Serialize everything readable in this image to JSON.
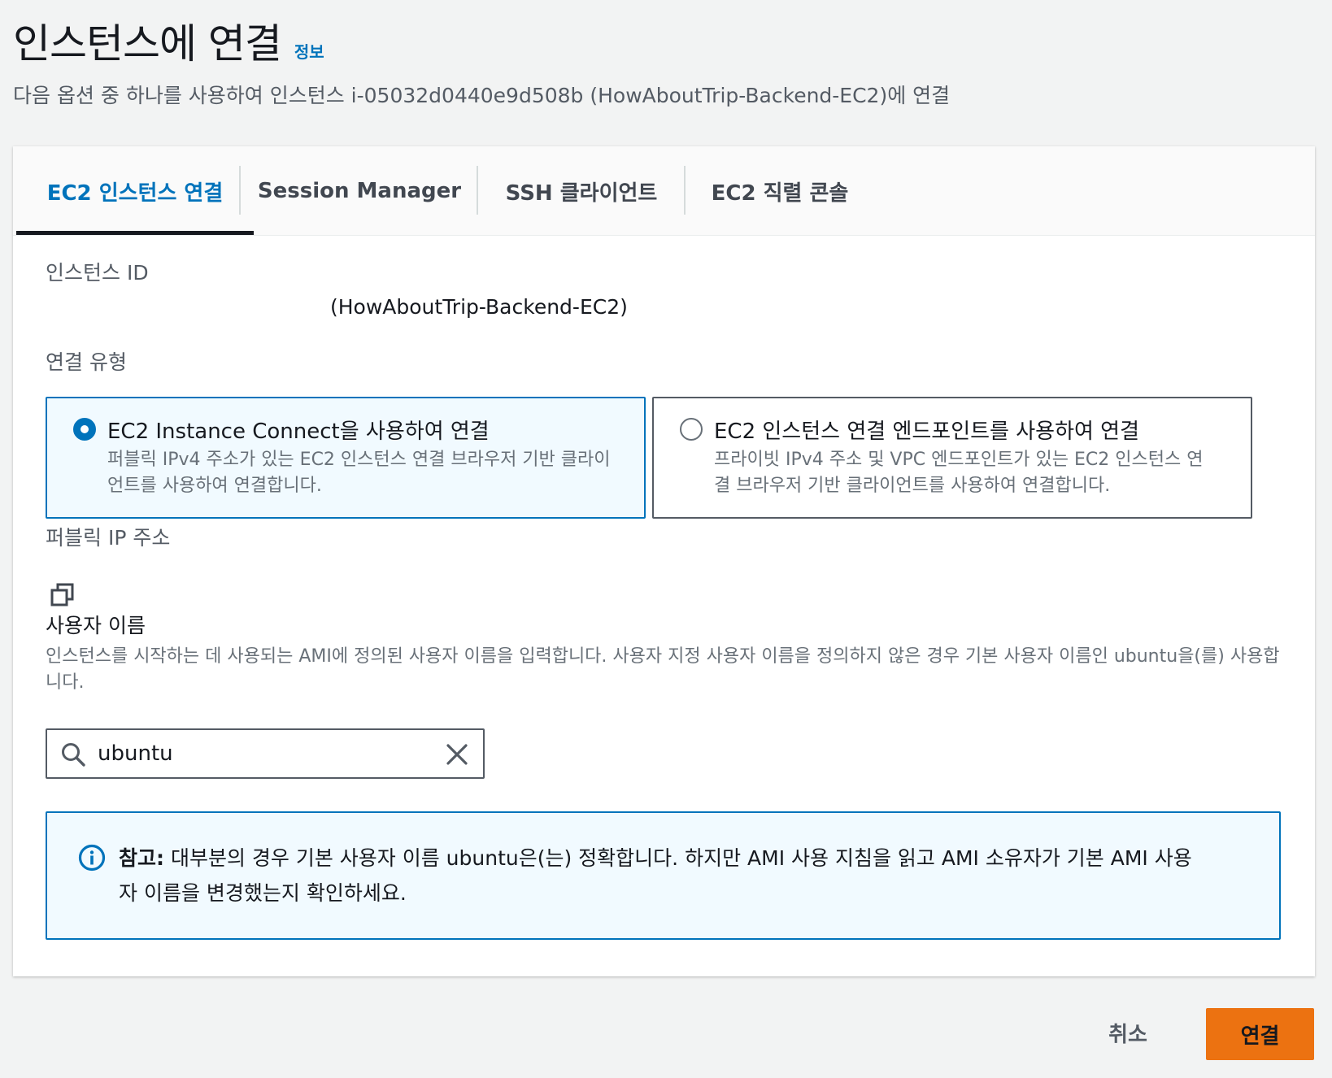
{
  "header": {
    "title": "인스턴스에 연결",
    "info_link": "정보",
    "subtitle": "다음 옵션 중 하나를 사용하여 인스턴스 i-05032d0440e9d508b (HowAboutTrip-Backend-EC2)에 연결"
  },
  "tabs": [
    {
      "label": "EC2 인스턴스 연결",
      "active": true
    },
    {
      "label": "Session Manager",
      "active": false
    },
    {
      "label": "SSH 클라이언트",
      "active": false
    },
    {
      "label": "EC2 직렬 콘솔",
      "active": false
    }
  ],
  "instance": {
    "label": "인스턴스 ID",
    "name_value": "(HowAboutTrip-Backend-EC2)"
  },
  "connection_type": {
    "label": "연결 유형",
    "options": [
      {
        "title": "EC2 Instance Connect을 사용하여 연결",
        "description": "퍼블릭 IPv4 주소가 있는 EC2 인스턴스 연결 브라우저 기반 클라이언트를 사용하여 연결합니다.",
        "selected": true
      },
      {
        "title": "EC2 인스턴스 연결 엔드포인트를 사용하여 연결",
        "description": "프라이빗 IPv4 주소 및 VPC 엔드포인트가 있는 EC2 인스턴스 연결 브라우저 기반 클라이언트를 사용하여 연결합니다.",
        "selected": false
      }
    ]
  },
  "public_ip": {
    "label": "퍼블릭 IP 주소",
    "copy_icon": "copy-icon"
  },
  "username": {
    "label": "사용자 이름",
    "help": "인스턴스를 시작하는 데 사용되는 AMI에 정의된 사용자 이름을 입력합니다. 사용자 지정 사용자 이름을 정의하지 않은 경우 기본 사용자 이름인 ubuntu을(를) 사용합니다.",
    "value": "ubuntu",
    "search_icon": "search-icon",
    "clear_icon": "close-icon"
  },
  "alert": {
    "strong": "참고:",
    "text": " 대부분의 경우 기본 사용자 이름 ubuntu은(는) 정확합니다. 하지만 AMI 사용 지침을 읽고 AMI 소유자가 기본 AMI 사용자 이름을 변경했는지 확인하세요.",
    "icon": "info-icon"
  },
  "footer": {
    "cancel_label": "취소",
    "connect_label": "연결"
  },
  "colors": {
    "accent": "#0073bb",
    "primary_button": "#ec7211",
    "background": "#f2f3f3"
  }
}
